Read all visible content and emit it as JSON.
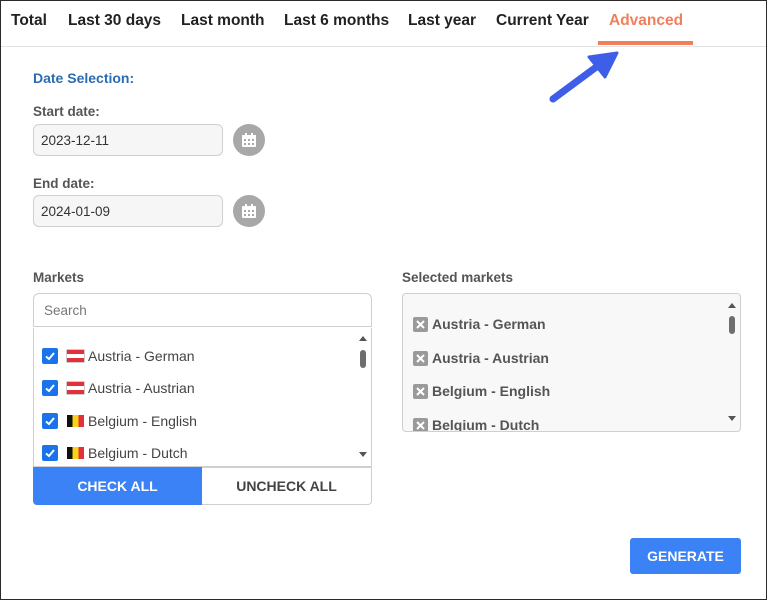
{
  "tabs": [
    {
      "label": "Total"
    },
    {
      "label": "Last 30 days"
    },
    {
      "label": "Last month"
    },
    {
      "label": "Last 6 months"
    },
    {
      "label": "Last year"
    },
    {
      "label": "Current Year"
    },
    {
      "label": "Advanced",
      "active": true
    }
  ],
  "accent_color": "#f07f5d",
  "primary_color": "#3b82f6",
  "date_selection": {
    "title": "Date Selection:",
    "start_label": "Start date:",
    "start_value": "2023-12-11",
    "end_label": "End date:",
    "end_value": "2024-01-09",
    "calendar_icon": "calendar-icon"
  },
  "markets": {
    "title": "Markets",
    "search_placeholder": "Search",
    "items": [
      {
        "label": "Austria - German",
        "flag": "austria",
        "checked": true
      },
      {
        "label": "Austria - Austrian",
        "flag": "austria",
        "checked": true
      },
      {
        "label": "Belgium - English",
        "flag": "belgium",
        "checked": true
      },
      {
        "label": "Belgium - Dutch",
        "flag": "belgium",
        "checked": true
      }
    ],
    "check_all_label": "CHECK ALL",
    "uncheck_all_label": "UNCHECK ALL"
  },
  "selected_markets": {
    "title": "Selected markets",
    "items": [
      {
        "label": "Austria - German"
      },
      {
        "label": "Austria - Austrian"
      },
      {
        "label": "Belgium - English"
      },
      {
        "label": "Belgium - Dutch"
      }
    ]
  },
  "generate_label": "GENERATE"
}
